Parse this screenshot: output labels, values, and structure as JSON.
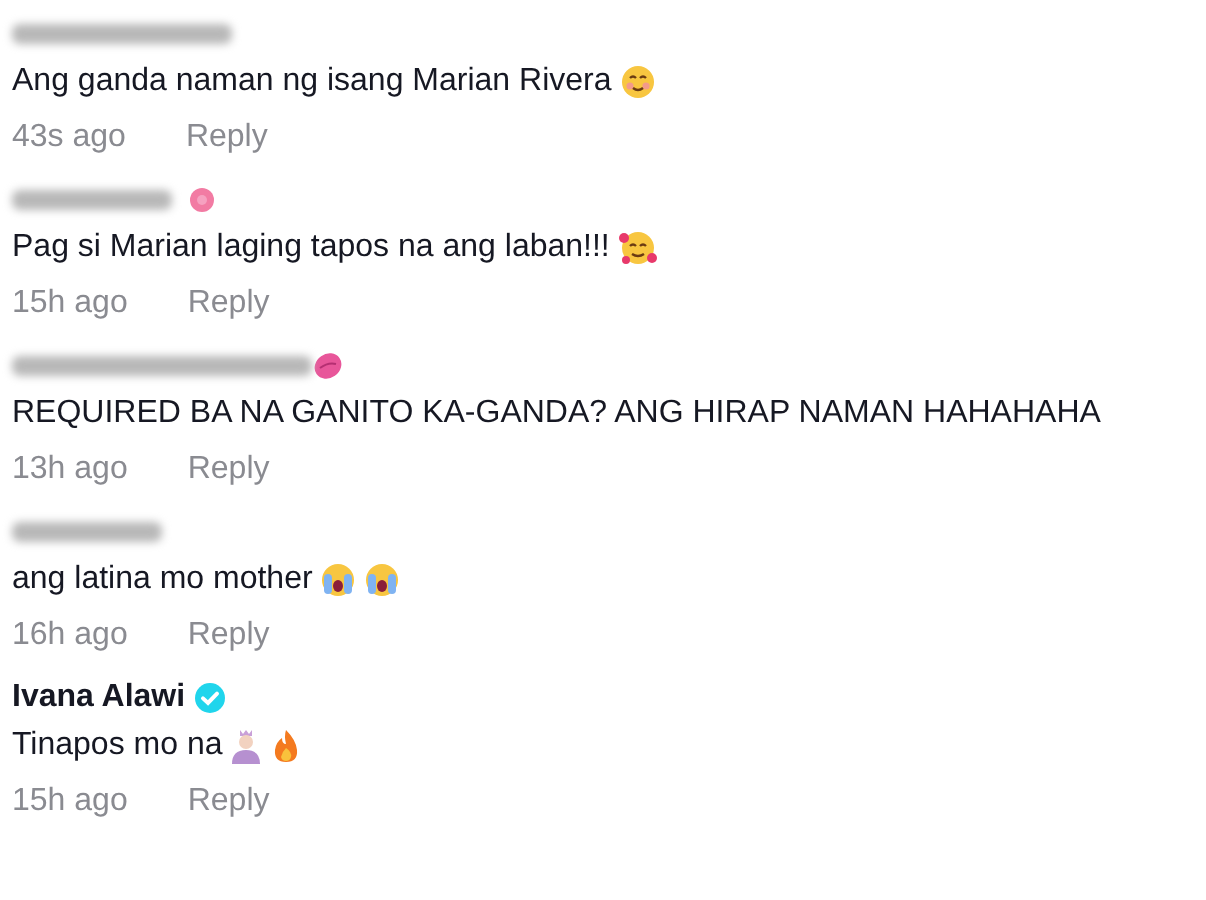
{
  "comments": [
    {
      "author": {
        "redacted": true
      },
      "text": "Ang ganda naman ng isang Marian Rivera",
      "emoji": [
        {
          "kind": "smile"
        }
      ],
      "time": "43s ago",
      "reply": "Reply"
    },
    {
      "author": {
        "redacted": true
      },
      "badge": {
        "kind": "flower"
      },
      "text": "Pag si Marian laging tapos na ang laban!!!",
      "emoji": [
        {
          "kind": "hearts"
        }
      ],
      "time": "15h ago",
      "reply": "Reply"
    },
    {
      "author": {
        "redacted": true
      },
      "badge": {
        "kind": "lips"
      },
      "text": "REQUIRED BA NA GANITO KA-GANDA? ANG HIRAP NAMAN HAHAHAHA",
      "time": "13h ago",
      "reply": "Reply"
    },
    {
      "author": {
        "redacted": true
      },
      "text": "ang latina mo mother",
      "emoji": [
        {
          "kind": "crying"
        },
        {
          "kind": "crying"
        }
      ],
      "time": "16h ago",
      "reply": "Reply"
    },
    {
      "author": {
        "name": "Ivana Alawi"
      },
      "badge": {
        "kind": "verified"
      },
      "text": "Tinapos mo na",
      "emoji": [
        {
          "kind": "princess"
        },
        {
          "kind": "fire"
        }
      ],
      "time": "15h ago",
      "reply": "Reply"
    }
  ]
}
